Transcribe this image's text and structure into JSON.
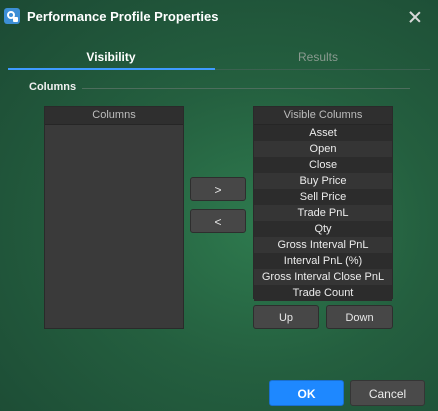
{
  "window": {
    "title": "Performance Profile Properties"
  },
  "tabs": [
    {
      "label": "Visibility",
      "active": true
    },
    {
      "label": "Results",
      "active": false
    }
  ],
  "section": {
    "label": "Columns"
  },
  "available_list": {
    "header": "Columns",
    "items": []
  },
  "visible_list": {
    "header": "Visible Columns",
    "items": [
      "Asset",
      "Open",
      "Close",
      "Buy Price",
      "Sell Price",
      "Trade PnL",
      "Qty",
      "Gross Interval PnL",
      "Interval PnL (%)",
      "Gross Interval Close PnL",
      "Trade Count"
    ]
  },
  "buttons": {
    "move_right": ">",
    "move_left": "<",
    "up": "Up",
    "down": "Down",
    "ok": "OK",
    "cancel": "Cancel"
  },
  "colors": {
    "accent": "#3f9bff",
    "ok_button": "#1e88ff",
    "background": "#245f3f"
  }
}
